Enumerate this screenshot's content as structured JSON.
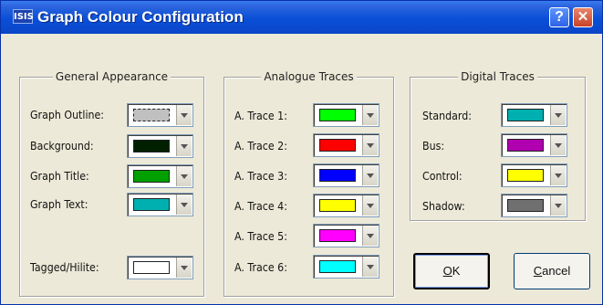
{
  "window": {
    "app_badge": "ISIS",
    "title": "Graph Colour Configuration",
    "help_label": "?",
    "close_label": "✕"
  },
  "groups": {
    "general": {
      "title": "General Appearance",
      "items": [
        {
          "label": "Graph Outline:",
          "color": "#c0c0c0"
        },
        {
          "label": "Background:",
          "color": "#002000"
        },
        {
          "label": "Graph Title:",
          "color": "#00a000"
        },
        {
          "label": "Graph Text:",
          "color": "#00b0b0"
        }
      ],
      "tagged": {
        "label": "Tagged/Hilite:",
        "color": "#ffffff"
      }
    },
    "analogue": {
      "title": "Analogue Traces",
      "items": [
        {
          "label": "A. Trace 1:",
          "color": "#00ff00"
        },
        {
          "label": "A. Trace 2:",
          "color": "#ff0000"
        },
        {
          "label": "A. Trace 3:",
          "color": "#0000ff"
        },
        {
          "label": "A. Trace 4:",
          "color": "#ffff00"
        },
        {
          "label": "A. Trace 5:",
          "color": "#ff00ff"
        },
        {
          "label": "A. Trace 6:",
          "color": "#00ffff"
        }
      ]
    },
    "digital": {
      "title": "Digital Traces",
      "items": [
        {
          "label": "Standard:",
          "color": "#00b0b0"
        },
        {
          "label": "Bus:",
          "color": "#b000b0"
        },
        {
          "label": "Control:",
          "color": "#ffff00"
        },
        {
          "label": "Shadow:",
          "color": "#707070"
        }
      ]
    }
  },
  "buttons": {
    "ok_mnemonic": "O",
    "ok_rest": "K",
    "cancel_mnemonic": "C",
    "cancel_rest": "ancel"
  }
}
